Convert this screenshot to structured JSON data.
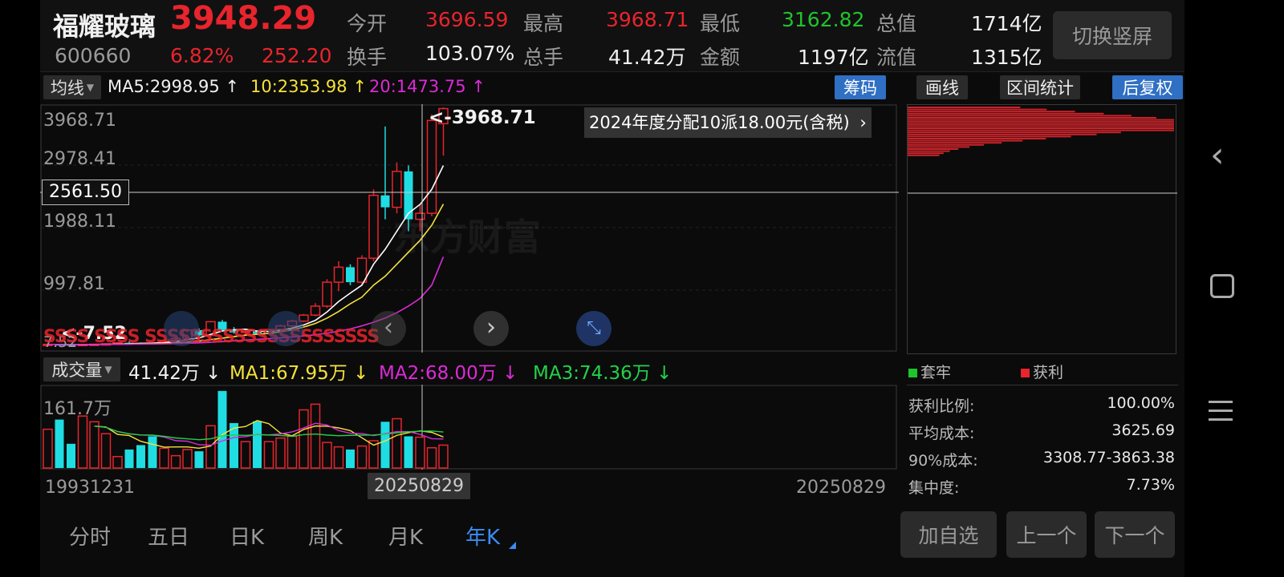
{
  "stock": {
    "name": "福耀玻璃",
    "price": "3948.29",
    "code": "600660",
    "pct": "6.82%",
    "change": "252.20"
  },
  "quote": {
    "open_label": "今开",
    "open": "3696.59",
    "high_label": "最高",
    "high": "3968.71",
    "low_label": "最低",
    "low": "3162.82",
    "mcap_label": "总值",
    "mcap": "1714亿",
    "turnover_label": "换手",
    "turnover": "103.07%",
    "vol_label": "总手",
    "vol": "41.42万",
    "amount_label": "金额",
    "amount": "1197亿",
    "float_label": "流值",
    "float": "1315亿"
  },
  "switch_vertical": "切换竖屏",
  "ma_bar": {
    "dropdown": "均线",
    "ma5": "MA5:2998.95",
    "ma10": "10:2353.98",
    "ma20": "20:1473.75",
    "arrow_up": "↑"
  },
  "tools": {
    "chips": "筹码",
    "draw": "画线",
    "range": "区间统计",
    "adjust": "后复权"
  },
  "price_axis": {
    "l1": "3968.71",
    "l2": "2978.41",
    "crosshair": "2561.50",
    "l3": "1988.11",
    "l4": "997.81",
    "l5": "7.52"
  },
  "annotations": {
    "high_mark": "<-3968.71",
    "low_mark": "<-7.52",
    "dividend": "2024年度分配10派18.00元(含税)",
    "watermark": "东方财富",
    "s_marks": "SSSS SSSS SSSSSSSSSSSSSSSSSSSSS"
  },
  "volume_bar": {
    "dropdown": "成交量",
    "value": "41.42万",
    "ma1": "MA1:67.95万",
    "ma2": "MA2:68.00万",
    "ma3": "MA3:74.36万",
    "arrow_down": "↓",
    "axis_max": "161.7万"
  },
  "dates": {
    "start": "19931231",
    "cursor": "20250829",
    "end": "20250829"
  },
  "tabs": [
    "分时",
    "五日",
    "日K",
    "周K",
    "月K",
    "年K"
  ],
  "chip_stats": {
    "trapped": "套牢",
    "profit": "获利",
    "profit_ratio_label": "获利比例:",
    "profit_ratio": "100.00%",
    "avg_cost_label": "平均成本:",
    "avg_cost": "3625.69",
    "cost90_label": "90%成本:",
    "cost90": "3308.77-3863.38",
    "concentration_label": "集中度:",
    "concentration": "7.73%"
  },
  "actions": {
    "add_watch": "加自选",
    "prev": "上一个",
    "next": "下一个"
  },
  "colors": {
    "up": "#e8242c",
    "down": "#1fdde2",
    "ma5": "#ffffff",
    "ma10": "#f5e23a",
    "ma20": "#dd2ad8",
    "btn_blue": "#2f6fc4"
  },
  "chart_data": {
    "type": "candlestick",
    "series": [
      {
        "candles": [
          {
            "o": 10,
            "h": 14,
            "l": 7.52,
            "c": 12
          },
          {
            "o": 12,
            "h": 18,
            "l": 9,
            "c": 9
          },
          {
            "o": 9,
            "h": 12,
            "l": 7.52,
            "c": 8
          },
          {
            "o": 8,
            "h": 11,
            "l": 7.6,
            "c": 10
          },
          {
            "o": 10,
            "h": 16,
            "l": 9,
            "c": 14
          },
          {
            "o": 14,
            "h": 22,
            "l": 12,
            "c": 20
          },
          {
            "o": 20,
            "h": 40,
            "l": 18,
            "c": 38
          },
          {
            "o": 38,
            "h": 60,
            "l": 30,
            "c": 36
          },
          {
            "o": 36,
            "h": 42,
            "l": 30,
            "c": 32
          },
          {
            "o": 32,
            "h": 38,
            "l": 25,
            "c": 28
          },
          {
            "o": 28,
            "h": 90,
            "l": 26,
            "c": 80
          },
          {
            "o": 80,
            "h": 120,
            "l": 70,
            "c": 110
          },
          {
            "o": 110,
            "h": 260,
            "l": 100,
            "c": 250
          },
          {
            "o": 250,
            "h": 280,
            "l": 150,
            "c": 160
          },
          {
            "o": 160,
            "h": 400,
            "l": 150,
            "c": 390
          },
          {
            "o": 390,
            "h": 420,
            "l": 220,
            "c": 250
          },
          {
            "o": 250,
            "h": 300,
            "l": 190,
            "c": 210
          },
          {
            "o": 210,
            "h": 260,
            "l": 170,
            "c": 230
          },
          {
            "o": 230,
            "h": 250,
            "l": 170,
            "c": 190
          },
          {
            "o": 190,
            "h": 270,
            "l": 180,
            "c": 260
          },
          {
            "o": 260,
            "h": 340,
            "l": 240,
            "c": 320
          },
          {
            "o": 320,
            "h": 420,
            "l": 300,
            "c": 400
          },
          {
            "o": 400,
            "h": 520,
            "l": 380,
            "c": 500
          },
          {
            "o": 500,
            "h": 700,
            "l": 480,
            "c": 650
          },
          {
            "o": 650,
            "h": 1100,
            "l": 620,
            "c": 1050
          },
          {
            "o": 1050,
            "h": 1400,
            "l": 900,
            "c": 1300
          },
          {
            "o": 1300,
            "h": 1350,
            "l": 1000,
            "c": 1050
          },
          {
            "o": 1050,
            "h": 1500,
            "l": 1000,
            "c": 1450
          },
          {
            "o": 1450,
            "h": 2600,
            "l": 1400,
            "c": 2500
          },
          {
            "o": 2500,
            "h": 3650,
            "l": 2100,
            "c": 2300
          },
          {
            "o": 2300,
            "h": 3050,
            "l": 2200,
            "c": 2900
          },
          {
            "o": 2900,
            "h": 3000,
            "l": 1900,
            "c": 2100
          },
          {
            "o": 2100,
            "h": 2350,
            "l": 1900,
            "c": 2200
          },
          {
            "o": 2200,
            "h": 3850,
            "l": 2150,
            "c": 3750
          },
          {
            "o": 3696.59,
            "h": 3968.71,
            "l": 3162.82,
            "c": 3948.29
          }
        ],
        "ma5": [
          11,
          11,
          10.5,
          10.2,
          10.6,
          12,
          16,
          22,
          28,
          32,
          43,
          57,
          90,
          120,
          178,
          235,
          254,
          264,
          232,
          228,
          244,
          283,
          336,
          412,
          552,
          727,
          867,
          1000,
          1350,
          1600,
          1900,
          2200,
          2350,
          2600,
          2998.95
        ],
        "ma10": [
          11,
          11,
          10.5,
          10.2,
          10.6,
          11,
          13,
          17,
          21,
          25,
          30,
          37,
          50,
          65,
          90,
          115,
          140,
          165,
          180,
          195,
          220,
          255,
          300,
          360,
          450,
          560,
          690,
          800,
          1000,
          1150,
          1350,
          1550,
          1750,
          2000,
          2353.98
        ],
        "ma20": [
          11,
          11,
          10.5,
          10.2,
          10.6,
          11,
          12,
          14,
          16,
          18,
          21,
          25,
          30,
          37,
          46,
          57,
          70,
          83,
          95,
          107,
          120,
          135,
          152,
          172,
          198,
          230,
          270,
          320,
          380,
          450,
          540,
          650,
          780,
          1000,
          1473.75
        ]
      }
    ],
    "volume": [
      88,
      110,
      55,
      118,
      105,
      78,
      26,
      42,
      52,
      72,
      45,
      28,
      42,
      38,
      96,
      175,
      102,
      60,
      106,
      60,
      68,
      72,
      132,
      145,
      58,
      48,
      42,
      50,
      62,
      105,
      112,
      72,
      70,
      46,
      52
    ],
    "ylim": [
      7.52,
      3968.71
    ]
  }
}
